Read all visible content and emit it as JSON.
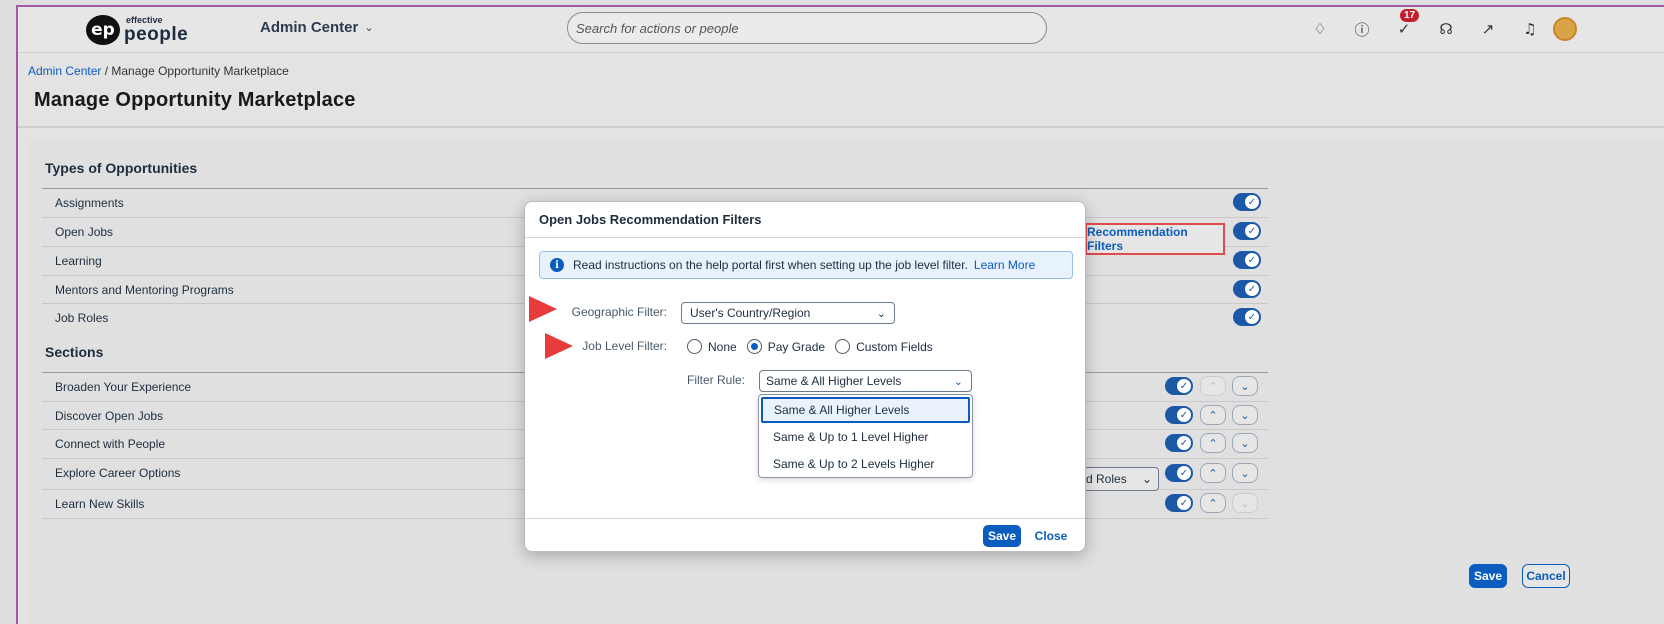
{
  "shell": {
    "logo_badge": "ep",
    "logo_small": "effective",
    "logo_big": "people",
    "product": "Admin Center",
    "search_placeholder": "Search for actions or people",
    "notification_count": "17"
  },
  "header": {
    "breadcrumb_link": "Admin Center",
    "breadcrumb_sep": " / ",
    "breadcrumb_current": "Manage Opportunity Marketplace",
    "title": "Manage Opportunity Marketplace"
  },
  "types": {
    "heading": "Types of Opportunities",
    "rows": [
      "Assignments",
      "Open Jobs",
      "Learning",
      "Mentors and Mentoring Programs",
      "Job Roles"
    ]
  },
  "sections": {
    "heading": "Sections",
    "rows": [
      "Broaden Your Experience",
      "Discover Open Jobs",
      "Connect with People",
      "Explore Career Options",
      "Learn New Skills"
    ]
  },
  "recommendation_filters_label": "Recommendation Filters",
  "roles_select_value": "d Roles",
  "main_actions": {
    "save": "Save",
    "cancel": "Cancel"
  },
  "dialog": {
    "title": "Open Jobs Recommendation Filters",
    "info_text": "Read instructions on the help portal first when setting up the job level filter.",
    "info_link": "Learn More",
    "geo_label": "Geographic Filter:",
    "geo_value": "User's Country/Region",
    "job_level_label": "Job Level Filter:",
    "job_level_options": [
      "None",
      "Pay Grade",
      "Custom Fields"
    ],
    "job_level_selected": "Pay Grade",
    "filter_rule_label": "Filter Rule:",
    "filter_rule_value": "Same & All Higher Levels",
    "filter_rule_options": [
      "Same & All Higher Levels",
      "Same & Up to 1 Level Higher",
      "Same & Up to 2 Levels Higher"
    ],
    "save": "Save",
    "close": "Close"
  },
  "colors": {
    "accent": "#0a5cbe",
    "toggle": "#1b59a7",
    "highlight_red": "#e04b4b",
    "badge_red": "#c21f2b"
  }
}
